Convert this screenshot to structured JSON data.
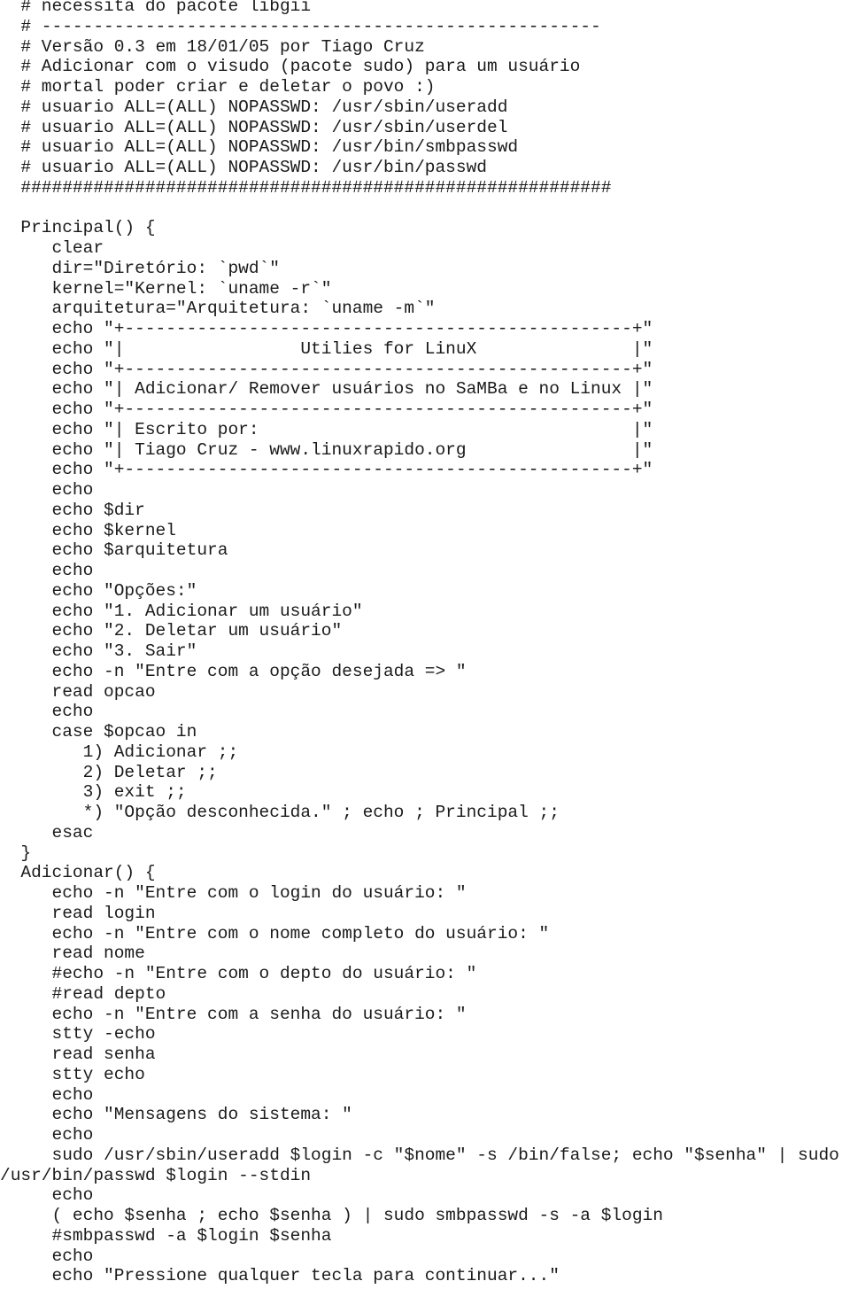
{
  "document": {
    "language": "shell",
    "lines": [
      "  # necessita do pacote libgii",
      "  # ------------------------------------------------------",
      "  # Versão 0.3 em 18/01/05 por Tiago Cruz",
      "  # Adicionar com o visudo (pacote sudo) para um usuário",
      "  # mortal poder criar e deletar o povo :)",
      "  # usuario ALL=(ALL) NOPASSWD: /usr/sbin/useradd",
      "  # usuario ALL=(ALL) NOPASSWD: /usr/sbin/userdel",
      "  # usuario ALL=(ALL) NOPASSWD: /usr/bin/smbpasswd",
      "  # usuario ALL=(ALL) NOPASSWD: /usr/bin/passwd",
      "  #########################################################",
      "",
      "  Principal() {",
      "     clear",
      "     dir=\"Diretório: `pwd`\"",
      "     kernel=\"Kernel: `uname -r`\"",
      "     arquitetura=\"Arquitetura: `uname -m`\"",
      "     echo \"+-------------------------------------------------+\"",
      "     echo \"|                 Utilies for LinuX               |\"",
      "     echo \"+-------------------------------------------------+\"",
      "     echo \"| Adicionar/ Remover usuários no SaMBa e no Linux |\"",
      "     echo \"+-------------------------------------------------+\"",
      "     echo \"| Escrito por:                                    |\"",
      "     echo \"| Tiago Cruz - www.linuxrapido.org                |\"",
      "     echo \"+-------------------------------------------------+\"",
      "     echo",
      "     echo $dir",
      "     echo $kernel",
      "     echo $arquitetura",
      "     echo",
      "     echo \"Opções:\"",
      "     echo \"1. Adicionar um usuário\"",
      "     echo \"2. Deletar um usuário\"",
      "     echo \"3. Sair\"",
      "     echo -n \"Entre com a opção desejada => \"",
      "     read opcao",
      "     echo",
      "     case $opcao in",
      "        1) Adicionar ;;",
      "        2) Deletar ;;",
      "        3) exit ;;",
      "        *) \"Opção desconhecida.\" ; echo ; Principal ;;",
      "     esac",
      "  }",
      "  Adicionar() {",
      "     echo -n \"Entre com o login do usuário: \"",
      "     read login",
      "     echo -n \"Entre com o nome completo do usuário: \"",
      "     read nome",
      "     #echo -n \"Entre com o depto do usuário: \"",
      "     #read depto",
      "     echo -n \"Entre com a senha do usuário: \"",
      "     stty -echo",
      "     read senha",
      "     stty echo",
      "     echo",
      "     echo \"Mensagens do sistema: \"",
      "     echo",
      "     sudo /usr/sbin/useradd $login -c \"$nome\" -s /bin/false; echo \"$senha\" | sudo",
      "/usr/bin/passwd $login --stdin",
      "     echo",
      "     ( echo $senha ; echo $senha ) | sudo smbpasswd -s -a $login",
      "     #smbpasswd -a $login $senha",
      "     echo",
      "     echo \"Pressione qualquer tecla para continuar...\""
    ]
  }
}
